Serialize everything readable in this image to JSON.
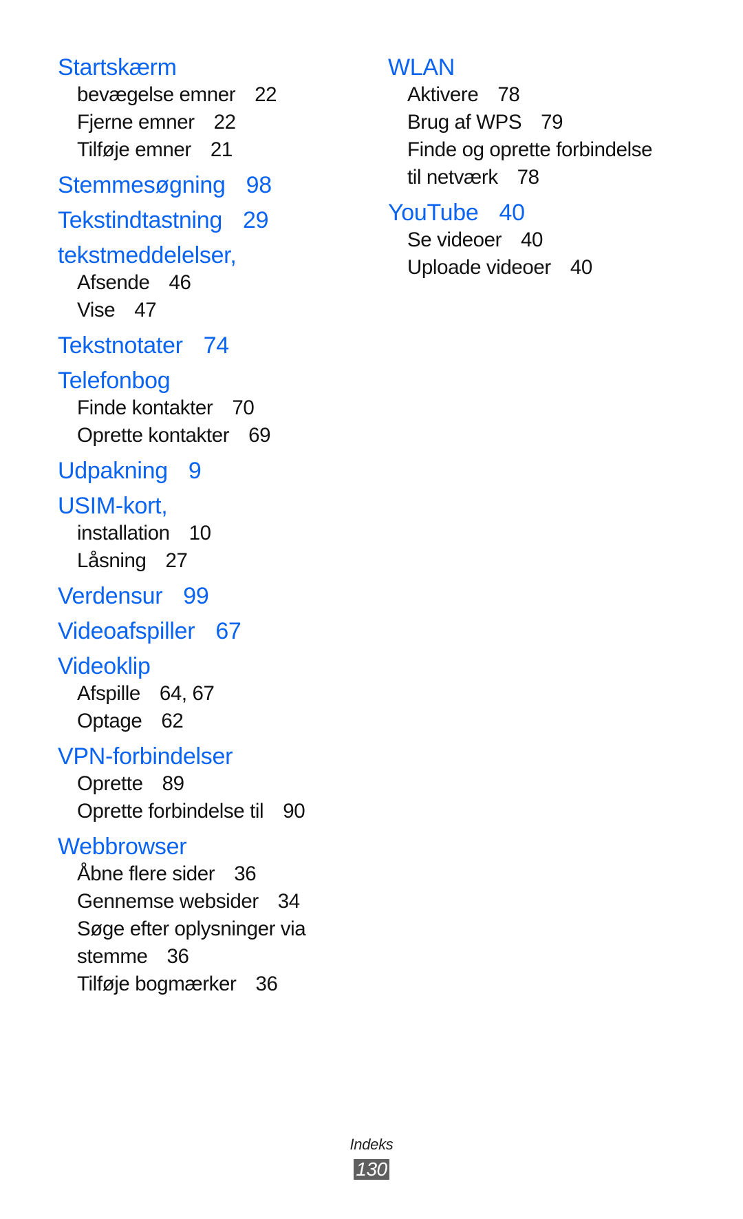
{
  "left_column": [
    {
      "term": "Startskærm",
      "page": "",
      "subs": [
        {
          "text": "bevægelse emner",
          "page": "22"
        },
        {
          "text": "Fjerne emner",
          "page": "22"
        },
        {
          "text": "Tilføje emner",
          "page": "21"
        }
      ]
    },
    {
      "term": "Stemmesøgning",
      "page": "98",
      "subs": []
    },
    {
      "term": "Tekstindtastning",
      "page": "29",
      "subs": []
    },
    {
      "term": "tekstmeddelelser,",
      "page": "",
      "subs": [
        {
          "text": "Afsende",
          "page": "46"
        },
        {
          "text": "Vise",
          "page": "47"
        }
      ]
    },
    {
      "term": "Tekstnotater",
      "page": "74",
      "subs": []
    },
    {
      "term": "Telefonbog",
      "page": "",
      "subs": [
        {
          "text": "Finde kontakter",
          "page": "70"
        },
        {
          "text": "Oprette kontakter",
          "page": "69"
        }
      ]
    },
    {
      "term": "Udpakning",
      "page": "9",
      "subs": []
    },
    {
      "term": "USIM-kort,",
      "page": "",
      "subs": [
        {
          "text": "installation",
          "page": "10"
        },
        {
          "text": "Låsning",
          "page": "27"
        }
      ]
    },
    {
      "term": "Verdensur",
      "page": "99",
      "subs": []
    },
    {
      "term": "Videoafspiller",
      "page": "67",
      "subs": []
    },
    {
      "term": "Videoklip",
      "page": "",
      "subs": [
        {
          "text": "Afspille",
          "page": "64, 67"
        },
        {
          "text": "Optage",
          "page": "62"
        }
      ]
    },
    {
      "term": "VPN-forbindelser",
      "page": "",
      "subs": [
        {
          "text": "Oprette",
          "page": "89"
        },
        {
          "text": "Oprette forbindelse til",
          "page": "90"
        }
      ]
    },
    {
      "term": "Webbrowser",
      "page": "",
      "subs": [
        {
          "text": "Åbne flere sider",
          "page": "36"
        },
        {
          "text": "Gennemse websider",
          "page": "34"
        },
        {
          "text": "Søge efter oplysninger via",
          "text2": "stemme",
          "page": "36"
        },
        {
          "text": "Tilføje bogmærker",
          "page": "36"
        }
      ]
    }
  ],
  "right_column": [
    {
      "term": "WLAN",
      "page": "",
      "subs": [
        {
          "text": "Aktivere",
          "page": "78"
        },
        {
          "text": "Brug af WPS",
          "page": "79"
        },
        {
          "text": "Finde og oprette forbindelse",
          "text2": "til netværk",
          "page": "78"
        }
      ]
    },
    {
      "term": "YouTube",
      "page": "40",
      "subs": [
        {
          "text": "Se videoer",
          "page": "40"
        },
        {
          "text": "Uploade videoer",
          "page": "40"
        }
      ]
    }
  ],
  "footer": {
    "section_label": "Indeks",
    "page_number": "130"
  },
  "colors": {
    "heading": "#0a64f0",
    "text": "#111111",
    "page_badge": "#5f5f5f"
  }
}
